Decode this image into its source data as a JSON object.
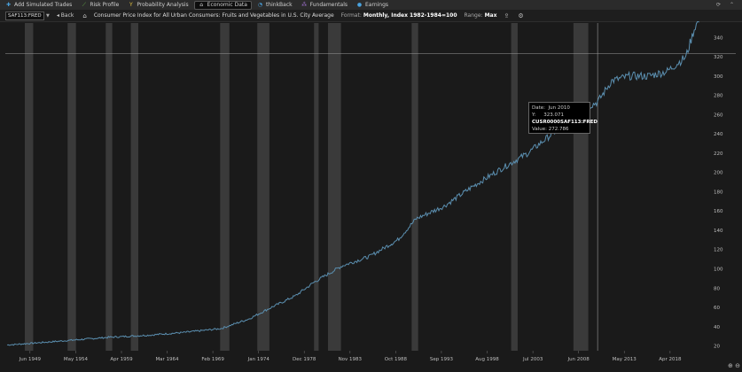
{
  "toolbar": {
    "items": [
      {
        "label": "Add Simulated Trades",
        "icon": "plus-icon",
        "color": "#4aa3df"
      },
      {
        "label": "Risk Profile",
        "icon": "risk-profile-icon",
        "color": "#6cbf4a"
      },
      {
        "label": "Probability Analysis",
        "icon": "probability-icon",
        "color": "#e0c040"
      },
      {
        "label": "Economic Data",
        "icon": "bank-icon",
        "color": "#dddddd"
      },
      {
        "label": "thinkBack",
        "icon": "thinkback-icon",
        "color": "#4aa3df"
      },
      {
        "label": "Fundamentals",
        "icon": "fundamentals-icon",
        "color": "#a070d0"
      },
      {
        "label": "Earnings",
        "icon": "earnings-icon",
        "color": "#4aa3df"
      }
    ],
    "active_index": 3
  },
  "subbar": {
    "symbol": "CUSR0000SAF113:FRED",
    "symbol_display": "SAF113:FRED",
    "back_label": "Back",
    "title": "Consumer Price Index for All Urban Consumers: Fruits and Vegetables in U.S. City Average",
    "format_label": "Format:",
    "format_value": "Monthly, Index 1982-1984=100",
    "range_label": "Range:",
    "range_value": "Max"
  },
  "tooltip": {
    "date_label": "Date:",
    "date_value": "Jun 2010",
    "y_label": "Y:",
    "y_value": "323.071",
    "series": "CUSR0000SAF113:FRED",
    "value_label": "Value:",
    "value_value": "272.786"
  },
  "chart_data": {
    "type": "line",
    "series": [
      {
        "name": "CUSR0000SAF113:FRED",
        "points": [
          [
            1947.0,
            21
          ],
          [
            1950,
            23
          ],
          [
            1954,
            26
          ],
          [
            1958,
            29
          ],
          [
            1962,
            31
          ],
          [
            1966,
            34
          ],
          [
            1970,
            38
          ],
          [
            1973,
            48
          ],
          [
            1975,
            58
          ],
          [
            1978,
            72
          ],
          [
            1980,
            86
          ],
          [
            1983,
            103
          ],
          [
            1986,
            113
          ],
          [
            1989,
            130
          ],
          [
            1991,
            152
          ],
          [
            1994,
            165
          ],
          [
            1997,
            185
          ],
          [
            2000,
            203
          ],
          [
            2003,
            220
          ],
          [
            2006,
            243
          ],
          [
            2008,
            262
          ],
          [
            2010.5,
            273
          ],
          [
            2012,
            295
          ],
          [
            2014,
            300
          ],
          [
            2016,
            300
          ],
          [
            2018,
            305
          ],
          [
            2020,
            320
          ],
          [
            2021,
            352
          ],
          [
            2021.6,
            360
          ]
        ]
      }
    ],
    "x_ticks": [
      "Jun 1949",
      "May 1954",
      "Apr 1959",
      "Mar 1964",
      "Feb 1969",
      "Jan 1974",
      "Dec 1978",
      "Nov 1983",
      "Oct 1988",
      "Sep 1993",
      "Aug 1998",
      "Jul 2003",
      "Jun 2008",
      "May 2013",
      "Apr 2018"
    ],
    "x_tick_values": [
      1949.45,
      1954.37,
      1959.29,
      1964.2,
      1969.12,
      1974.04,
      1978.95,
      1983.87,
      1988.79,
      1993.7,
      1998.62,
      2003.54,
      2008.45,
      2013.37,
      2018.29
    ],
    "y_ticks": [
      20,
      40,
      60,
      80,
      100,
      120,
      140,
      160,
      180,
      200,
      220,
      240,
      260,
      280,
      300,
      320,
      340
    ],
    "xlim": [
      1946.8,
      2022.5
    ],
    "ylim": [
      15,
      355
    ],
    "crosshair": {
      "x": 2010.5,
      "y": 323.071
    },
    "recessions": [
      [
        1948.9,
        1949.8
      ],
      [
        1953.5,
        1954.4
      ],
      [
        1957.6,
        1958.3
      ],
      [
        1960.3,
        1961.1
      ],
      [
        1969.9,
        1970.9
      ],
      [
        1973.9,
        1975.2
      ],
      [
        1980.0,
        1980.5
      ],
      [
        1981.5,
        1982.9
      ],
      [
        1990.5,
        1991.2
      ],
      [
        2001.2,
        2001.9
      ],
      [
        2007.9,
        2009.5
      ]
    ],
    "colors": {
      "line": "#5b8fb0",
      "recession": "#3a3a3a",
      "background": "#1a1a1a",
      "grid": "#2a2a2a"
    }
  }
}
